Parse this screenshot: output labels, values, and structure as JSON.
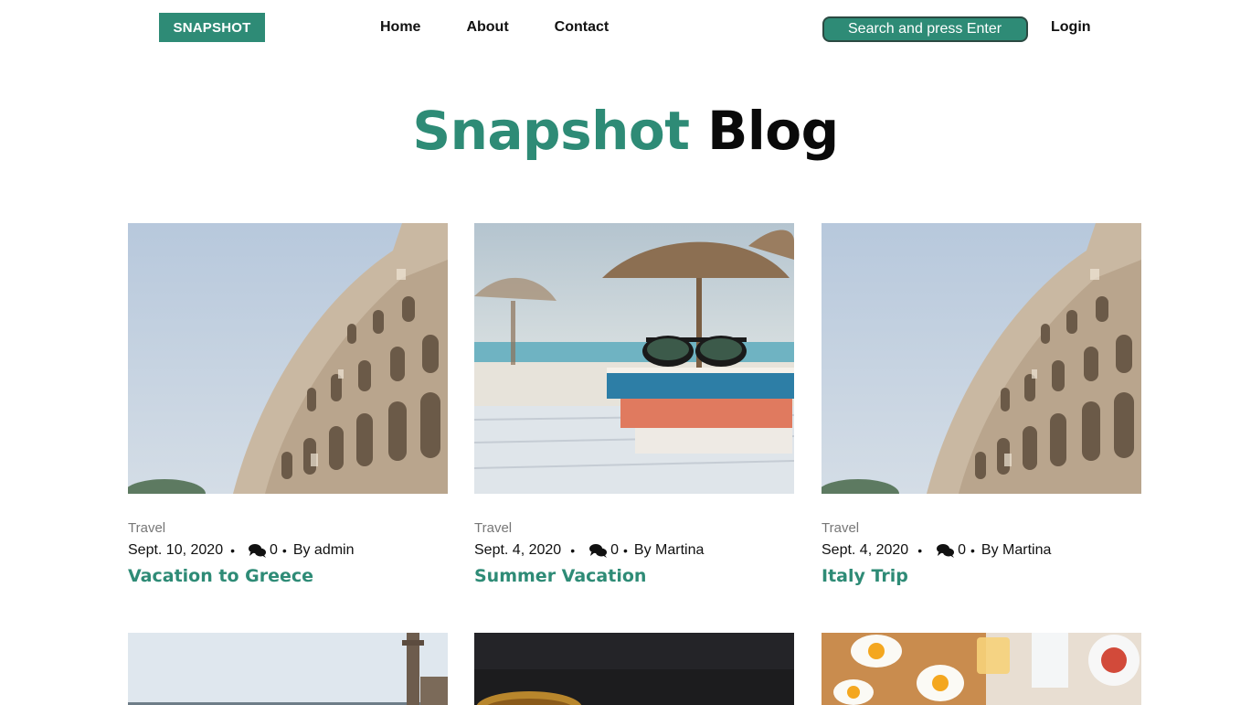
{
  "header": {
    "brand": "SNAPSHOT",
    "nav": [
      "Home",
      "About",
      "Contact"
    ],
    "search_placeholder": "Search and press Enter",
    "login_label": "Login"
  },
  "hero": {
    "accent": "Snapshot",
    "rest": "Blog"
  },
  "colors": {
    "accent": "#2e8b76",
    "text": "#111111",
    "muted": "#777777"
  },
  "posts": [
    {
      "category": "Travel",
      "date": "Sept. 10, 2020",
      "comments": "0",
      "author": "By admin",
      "title": "Vacation to Greece",
      "image": "colosseum"
    },
    {
      "category": "Travel",
      "date": "Sept. 4, 2020",
      "comments": "0",
      "author": "By Martina",
      "title": "Summer Vacation",
      "image": "beach-books"
    },
    {
      "category": "Travel",
      "date": "Sept. 4, 2020",
      "comments": "0",
      "author": "By Martina",
      "title": "Italy Trip",
      "image": "colosseum"
    }
  ],
  "more_posts": [
    {
      "image": "column-sky"
    },
    {
      "image": "dark-table-bowl"
    },
    {
      "image": "breakfast"
    }
  ]
}
